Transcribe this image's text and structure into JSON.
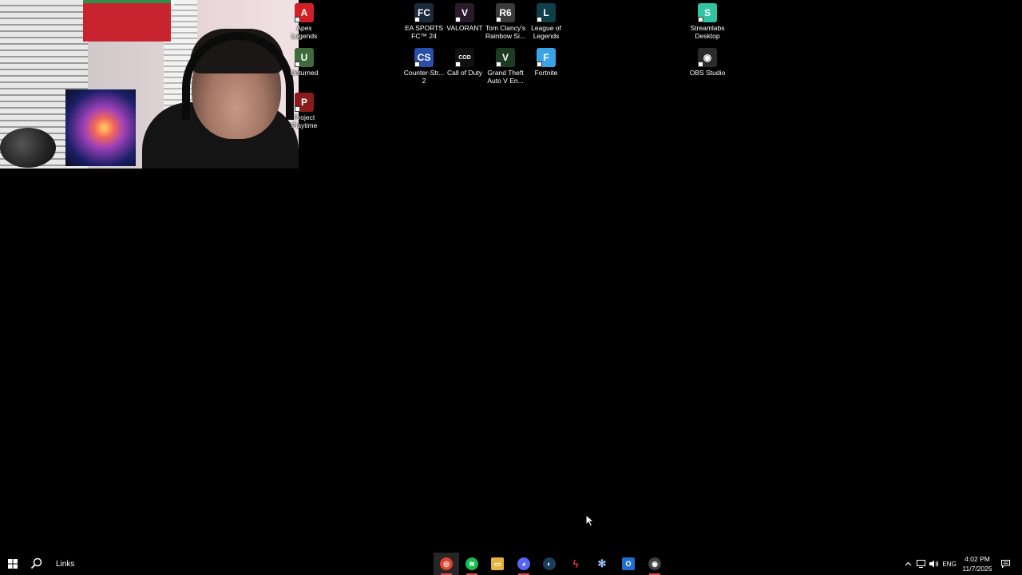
{
  "desktop": {
    "icons": [
      {
        "label": "Apex\nLegends",
        "icon": "apex-legends-icon",
        "color": "#d21f26",
        "glyph": "A"
      },
      {
        "label": "Unturned",
        "icon": "unturned-icon",
        "color": "#3f6a3a",
        "glyph": "U"
      },
      {
        "label": "Project\nPlaytime",
        "icon": "project-playtime-icon",
        "color": "#8b1c1c",
        "glyph": "P"
      },
      {
        "label": "EA SPORTS\nFC™ 24",
        "icon": "ea-sports-fc-icon",
        "color": "#1b2a3a",
        "glyph": "FC"
      },
      {
        "label": "VALORANT",
        "icon": "valorant-icon",
        "color": "#2a1a2a",
        "glyph": "V"
      },
      {
        "label": "Tom Clancy's\nRainbow Si...",
        "icon": "rainbow-six-icon",
        "color": "#3a3a3a",
        "glyph": "R6"
      },
      {
        "label": "League of\nLegends",
        "icon": "league-of-legends-icon",
        "color": "#0f3f4a",
        "glyph": "L"
      },
      {
        "label": "Counter-Str...\n2",
        "icon": "counter-strike-icon",
        "color": "#2a4fa8",
        "glyph": "CS"
      },
      {
        "label": "Call of Duty",
        "icon": "call-of-duty-icon",
        "color": "#101010",
        "glyph": "COD"
      },
      {
        "label": "Grand Theft\nAuto V En...",
        "icon": "gta-v-icon",
        "color": "#1d3b22",
        "glyph": "V"
      },
      {
        "label": "Fortnite",
        "icon": "fortnite-icon",
        "color": "#3aa3e6",
        "glyph": "F"
      },
      {
        "label": "Streamlabs\nDesktop",
        "icon": "streamlabs-icon",
        "color": "#31c3a2",
        "glyph": "S"
      },
      {
        "label": "OBS Studio",
        "icon": "obs-studio-icon",
        "color": "#2b2b2b",
        "glyph": "◉"
      }
    ]
  },
  "taskbar": {
    "start_icon": "windows-start-icon",
    "search_label": "Links",
    "apps": [
      {
        "name": "chrome",
        "icon": "chrome-icon",
        "color": "#e0442d",
        "glyph": "◎",
        "active": true
      },
      {
        "name": "spotify",
        "icon": "spotify-icon",
        "color": "#1db954",
        "glyph": "≋",
        "active": false
      },
      {
        "name": "file-explorer",
        "icon": "file-explorer-icon",
        "color": "#e6b33c",
        "glyph": "▭",
        "active": false
      },
      {
        "name": "discord",
        "icon": "discord-icon",
        "color": "#5865f2",
        "glyph": "◕",
        "active": false
      },
      {
        "name": "steam",
        "icon": "steam-icon",
        "color": "#1b3c5c",
        "glyph": "◐",
        "active": false
      },
      {
        "name": "riot-client",
        "icon": "riot-client-icon",
        "color": "#d13639",
        "glyph": "ϟ",
        "active": false
      },
      {
        "name": "pinwheel-app",
        "icon": "pinwheel-app-icon",
        "color": "#3a6fd8",
        "glyph": "✻",
        "active": false
      },
      {
        "name": "outlook",
        "icon": "outlook-icon",
        "color": "#1f6fd1",
        "glyph": "O",
        "active": false
      },
      {
        "name": "obs",
        "icon": "obs-icon",
        "color": "#404040",
        "glyph": "◉",
        "active": false
      }
    ],
    "tray": {
      "language": "ENG",
      "time": "4:02 PM",
      "date": "11/7/2025"
    }
  }
}
